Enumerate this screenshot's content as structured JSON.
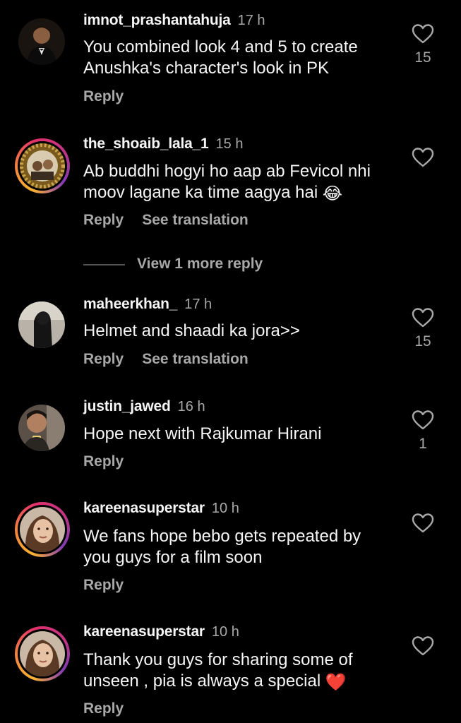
{
  "colors": {
    "background": "#000000",
    "primary_text": "#f5f5f5",
    "secondary_text": "#a8a8a8",
    "heart_red": "#e0283a"
  },
  "labels": {
    "reply": "Reply",
    "see_translation": "See translation",
    "view_more": "View 1 more reply"
  },
  "comments": [
    {
      "username": "imnot_prashantahuja",
      "time": "17 h",
      "text_lines": [
        "You combined look 4 and 5 to create",
        "Anushka's character's look in PK"
      ],
      "likes": "15",
      "story_ring": false,
      "see_translation": false
    },
    {
      "username": "the_shoaib_lala_1",
      "time": "15 h",
      "text_lines": [
        "Ab buddhi hogyi ho aap ab Fevicol nhi",
        "moov lagane ka time aagya hai"
      ],
      "emoji": "😂",
      "likes": "",
      "story_ring": true,
      "see_translation": true
    },
    {
      "username": "maheerkhan_",
      "time": "17 h",
      "text_lines": [
        "Helmet and shaadi ka jora>>"
      ],
      "likes": "15",
      "story_ring": false,
      "see_translation": true
    },
    {
      "username": "justin_jawed",
      "time": "16 h",
      "text_lines": [
        "Hope next with Rajkumar Hirani"
      ],
      "likes": "1",
      "story_ring": false,
      "see_translation": false
    },
    {
      "username": "kareenasuperstar",
      "time": "10 h",
      "text_lines": [
        "We fans hope bebo gets repeated by",
        "you guys for a film soon"
      ],
      "likes": "",
      "story_ring": true,
      "see_translation": false
    },
    {
      "username": "kareenasuperstar",
      "time": "10 h",
      "text_lines": [
        "Thank you guys for sharing some of",
        "unseen , pia is always a special"
      ],
      "emoji": "❤️",
      "likes": "",
      "story_ring": true,
      "see_translation": false
    }
  ]
}
